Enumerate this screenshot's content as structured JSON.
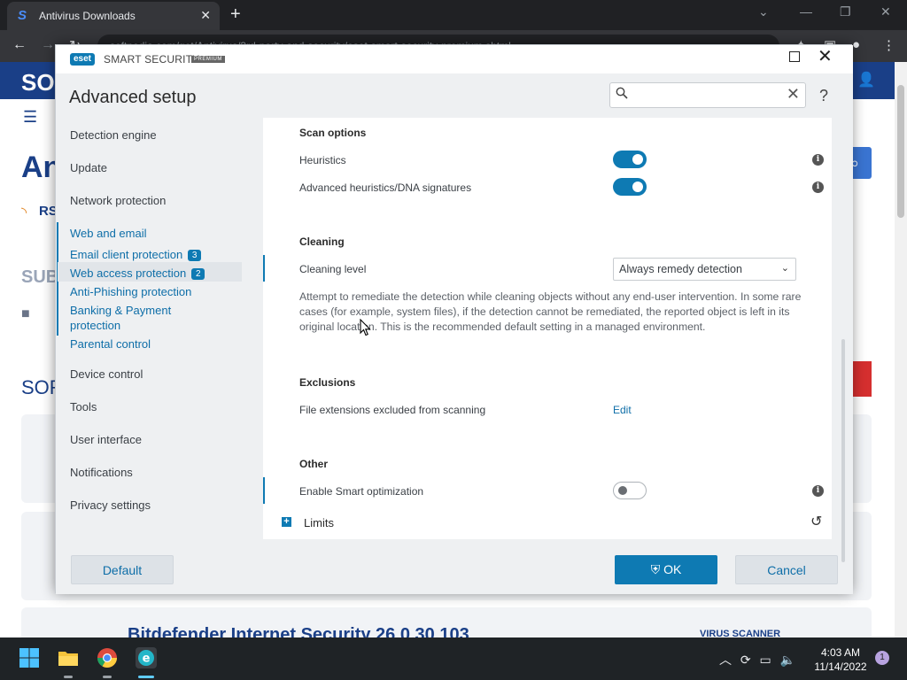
{
  "browser": {
    "tab_title": "Antivirus Downloads",
    "tab_favicon": "S",
    "url": "softpedia.com/get/Antivirus/3rd-party-and-security/eset-smart-security-premium.shtml"
  },
  "website": {
    "logo": "SO",
    "big_title": "An",
    "rss_label": "RS",
    "sub_heading": "SUB",
    "folder_text": "I",
    "sort_label": "SOR",
    "bottom_title": "Bitdefender Internet Security 26.0.30.103",
    "virus_label": "VIRUS SCANNER"
  },
  "dialog": {
    "brand": "SMART SECURITY",
    "logo_text": "eset",
    "premium": "PREMIUM",
    "heading": "Advanced setup",
    "search": {
      "value": "",
      "placeholder": ""
    },
    "help": "?"
  },
  "nav": {
    "items": [
      {
        "label": "Detection engine"
      },
      {
        "label": "Update"
      },
      {
        "label": "Network protection"
      },
      {
        "label": "Web and email"
      },
      {
        "label": "Email client protection",
        "badge": "3"
      },
      {
        "label": "Web access protection",
        "badge": "2"
      },
      {
        "label": "Anti-Phishing protection"
      },
      {
        "label": "Banking & Payment"
      },
      {
        "label": "protection"
      },
      {
        "label": "Parental control"
      },
      {
        "label": "Device control"
      },
      {
        "label": "Tools"
      },
      {
        "label": "User interface"
      },
      {
        "label": "Notifications"
      },
      {
        "label": "Privacy settings"
      }
    ]
  },
  "content": {
    "scan_options": {
      "title": "Scan options",
      "heuristics": {
        "label": "Heuristics",
        "enabled": true
      },
      "advanced": {
        "label": "Advanced heuristics/DNA signatures",
        "enabled": true
      }
    },
    "cleaning": {
      "title": "Cleaning",
      "level_label": "Cleaning level",
      "level_value": "Always remedy detection",
      "description": "Attempt to remediate the detection while cleaning objects without any end-user intervention. In some rare cases (for example, system files), if the detection cannot be remediated, the reported object is left in its original location. This is the recommended default setting in a managed environment."
    },
    "exclusions": {
      "title": "Exclusions",
      "label": "File extensions excluded from scanning",
      "edit": "Edit"
    },
    "other": {
      "title": "Other",
      "smart_label": "Enable Smart optimization",
      "smart_enabled": false
    },
    "limits": "Limits"
  },
  "buttons": {
    "default": "Default",
    "ok": "OK",
    "cancel": "Cancel"
  },
  "taskbar": {
    "time": "4:03 AM",
    "date": "11/14/2022",
    "notifications": "1"
  }
}
